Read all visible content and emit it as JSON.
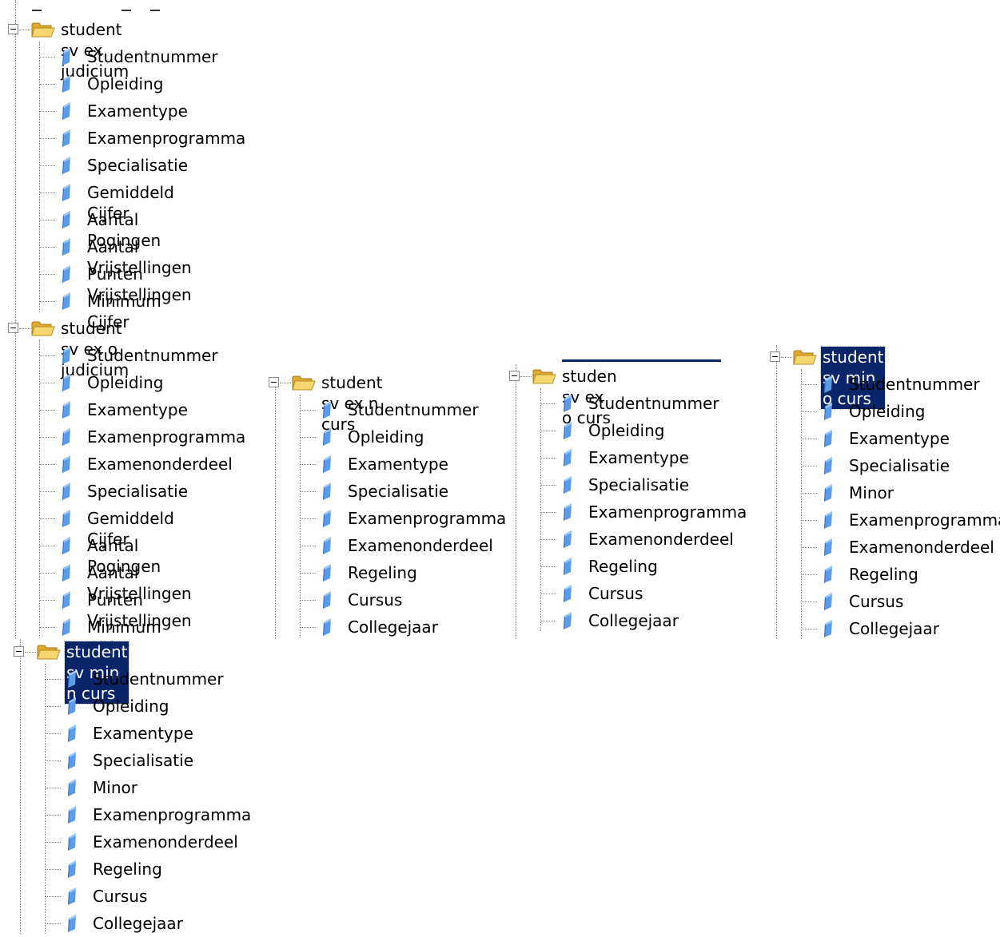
{
  "trees": [
    {
      "label": "student sv ex judicium",
      "selected": false,
      "fields": [
        "Studentnummer",
        "Opleiding",
        "Examentype",
        "Examenprogramma",
        "Specialisatie",
        "Gemiddeld Cijfer",
        "Aantal Pogingen",
        "Aantal Vrijstellingen",
        "Punten Vrijstellingen",
        "Minimum Cijfer"
      ]
    },
    {
      "label": "student sv ex o judicium",
      "selected": false,
      "fields": [
        "Studentnummer",
        "Opleiding",
        "Examentype",
        "Examenprogramma",
        "Examenonderdeel",
        "Specialisatie",
        "Gemiddeld Cijfer",
        "Aantal Pogingen",
        "Aantal Vrijstellingen",
        "Punten Vrijstellingen",
        "Minimum Cijfer"
      ]
    },
    {
      "label": "student sv ex n curs",
      "selected": false,
      "fields": [
        "Studentnummer",
        "Opleiding",
        "Examentype",
        "Specialisatie",
        "Examenprogramma",
        "Examenonderdeel",
        "Regeling",
        "Cursus",
        "Collegejaar"
      ]
    },
    {
      "label": "studen sv ex o curs",
      "selected": false,
      "fields": [
        "Studentnummer",
        "Opleiding",
        "Examentype",
        "Specialisatie",
        "Examenprogramma",
        "Examenonderdeel",
        "Regeling",
        "Cursus",
        "Collegejaar"
      ]
    },
    {
      "label": "student sv min o curs",
      "selected": true,
      "fields": [
        "Studentnummer",
        "Opleiding",
        "Examentype",
        "Specialisatie",
        "Minor",
        "Examenprogramma",
        "Examenonderdeel",
        "Regeling",
        "Cursus",
        "Collegejaar"
      ]
    },
    {
      "label": "student sv min n curs",
      "selected": true,
      "fields": [
        "Studentnummer",
        "Opleiding",
        "Examentype",
        "Specialisatie",
        "Minor",
        "Examenprogramma",
        "Examenonderdeel",
        "Regeling",
        "Cursus",
        "Collegejaar"
      ]
    }
  ],
  "icons": {
    "folder": "open-folder-icon",
    "field": "field-icon",
    "expander": "collapse-icon"
  },
  "colors": {
    "selection": "#0a246a",
    "folder": "#f2c94c",
    "field": "#4a8fe0"
  }
}
